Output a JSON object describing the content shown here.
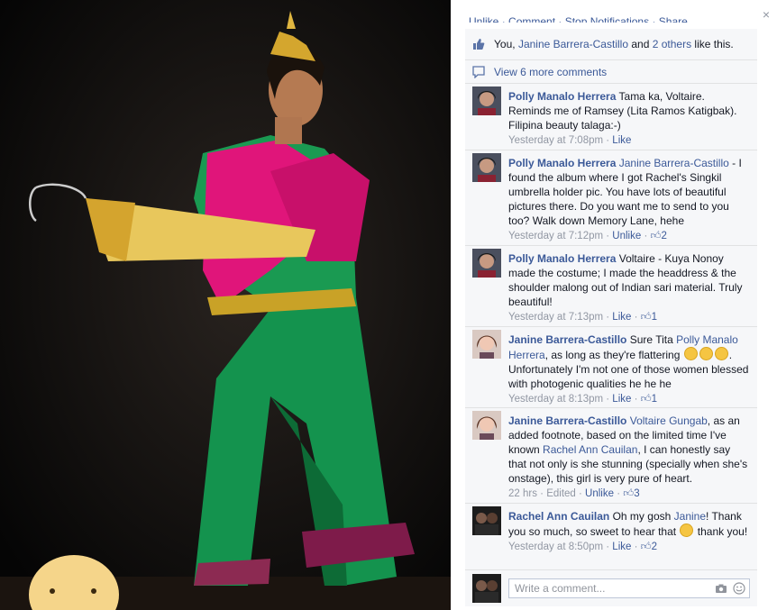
{
  "close_label": "×",
  "actions": [
    "Unlike",
    "Comment",
    "Stop Notifications",
    "Share"
  ],
  "likes": {
    "you": "You,",
    "person": "Janine Barrera-Castillo",
    "and": "and",
    "others": "2 others",
    "suffix": "like this."
  },
  "view_more": "View 6 more comments",
  "comments": [
    {
      "author": "Polly Manalo Herrera",
      "text": "Tama ka, Voltaire. Reminds me of Ramsey (Lita Ramos Katigbak). Filipina beauty talaga:-)",
      "time": "Yesterday at 7:08pm",
      "like": "Like"
    },
    {
      "author": "Polly Manalo Herrera",
      "mention": "Janine Barrera-Castillo",
      "text": "- I found the album where I got Rachel's Singkil umbrella holder pic. You have lots of beautiful pictures there. Do you want me to send to you too? Walk down Memory Lane, hehe",
      "time": "Yesterday at 7:12pm",
      "like": "Unlike",
      "count": "2"
    },
    {
      "author": "Polly Manalo Herrera",
      "text": "Voltaire - Kuya Nonoy made the costume; I made the headdress & the shoulder malong out of Indian sari material. Truly beautiful!",
      "time": "Yesterday at 7:13pm",
      "like": "Like",
      "count": "1"
    },
    {
      "author": "Janine Barrera-Castillo",
      "pre": "Sure Tita",
      "mention": "Polly Manalo Herrera",
      "text": ", as long as they're flattering",
      "post": ". Unfortunately I'm not one of those women blessed with photogenic qualities he he he",
      "time": "Yesterday at 8:13pm",
      "like": "Like",
      "count": "1"
    },
    {
      "author": "Janine Barrera-Castillo",
      "mention": "Voltaire Gungab",
      "text": ", as an added footnote, based on the limited time I've known",
      "mention2": "Rachel Ann Cauilan",
      "post": ", I can honestly say that not only is she stunning (specially when she's onstage), this girl is very pure of heart.",
      "time": "22 hrs",
      "edited": "Edited",
      "like": "Unlike",
      "count": "3"
    },
    {
      "author": "Rachel Ann Cauilan",
      "pre": "Oh my gosh",
      "mention": "Janine",
      "text": "! Thank you so much, so sweet to hear that",
      "post": "thank you!",
      "time": "Yesterday at 8:50pm",
      "like": "Like",
      "count": "2"
    }
  ],
  "write_placeholder": "Write a comment...",
  "icons": [
    "close-icon",
    "like-thumb-icon",
    "comment-bubble-icon",
    "camera-icon",
    "smiley-icon"
  ]
}
